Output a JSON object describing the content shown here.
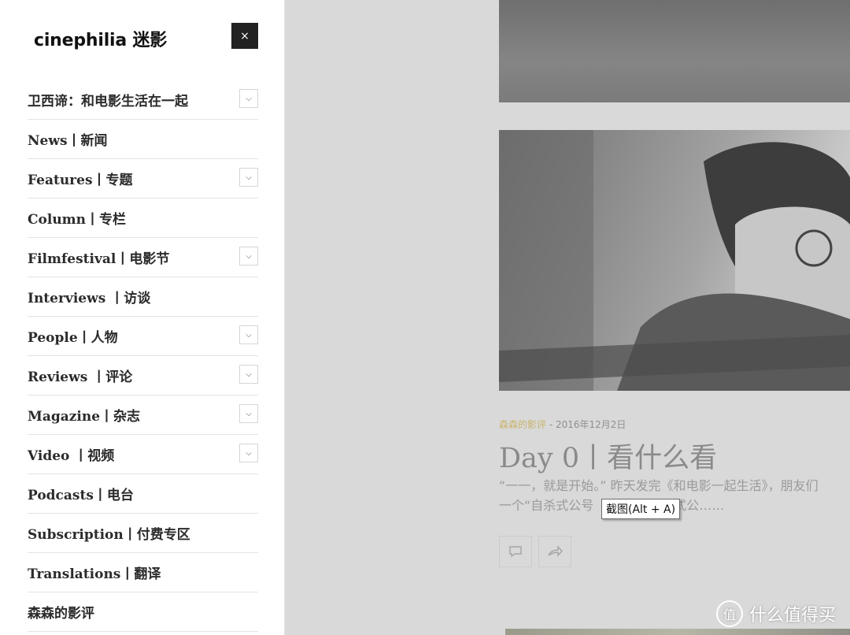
{
  "sidebar": {
    "logo": "cinephilia 迷影",
    "close_label": "×",
    "items": [
      {
        "label": "卫西谛：和电影生活在一起",
        "has_submenu": true
      },
      {
        "label": "News丨新闻",
        "has_submenu": false
      },
      {
        "label": "Features丨专题",
        "has_submenu": true
      },
      {
        "label": "Column丨专栏",
        "has_submenu": false
      },
      {
        "label": "Filmfestival丨电影节",
        "has_submenu": true
      },
      {
        "label": "Interviews 丨访谈",
        "has_submenu": false
      },
      {
        "label": "People丨人物",
        "has_submenu": true
      },
      {
        "label": "Reviews 丨评论",
        "has_submenu": true
      },
      {
        "label": "Magazine丨杂志",
        "has_submenu": true
      },
      {
        "label": "Video 丨视频",
        "has_submenu": true
      },
      {
        "label": "Podcasts丨电台",
        "has_submenu": false
      },
      {
        "label": "Subscription丨付费专区",
        "has_submenu": false
      },
      {
        "label": "Translations丨翻译",
        "has_submenu": false
      },
      {
        "label": "森森的影评",
        "has_submenu": false
      }
    ],
    "chevron_icon": "chevron-down-icon"
  },
  "post": {
    "author": "森森的影评",
    "date_sep": " - ",
    "date": "2016年12月2日",
    "title": "Day 0丨看什么看",
    "excerpt_line1": "“一一，就是开始。” 昨天发完《和电影一起生活》，朋友们",
    "excerpt_line2": "一个“自杀式公号",
    "excerpt_line2_tail": "式公……",
    "comment_icon": "comment-icon",
    "share_icon": "share-icon"
  },
  "tooltip": "截图(Alt + A)",
  "watermark": {
    "icon": "值",
    "text": "什么值得买"
  },
  "colors": {
    "overlay": "#d9d9d9",
    "author_accent": "#c9b36a",
    "close_bg": "#222222"
  }
}
